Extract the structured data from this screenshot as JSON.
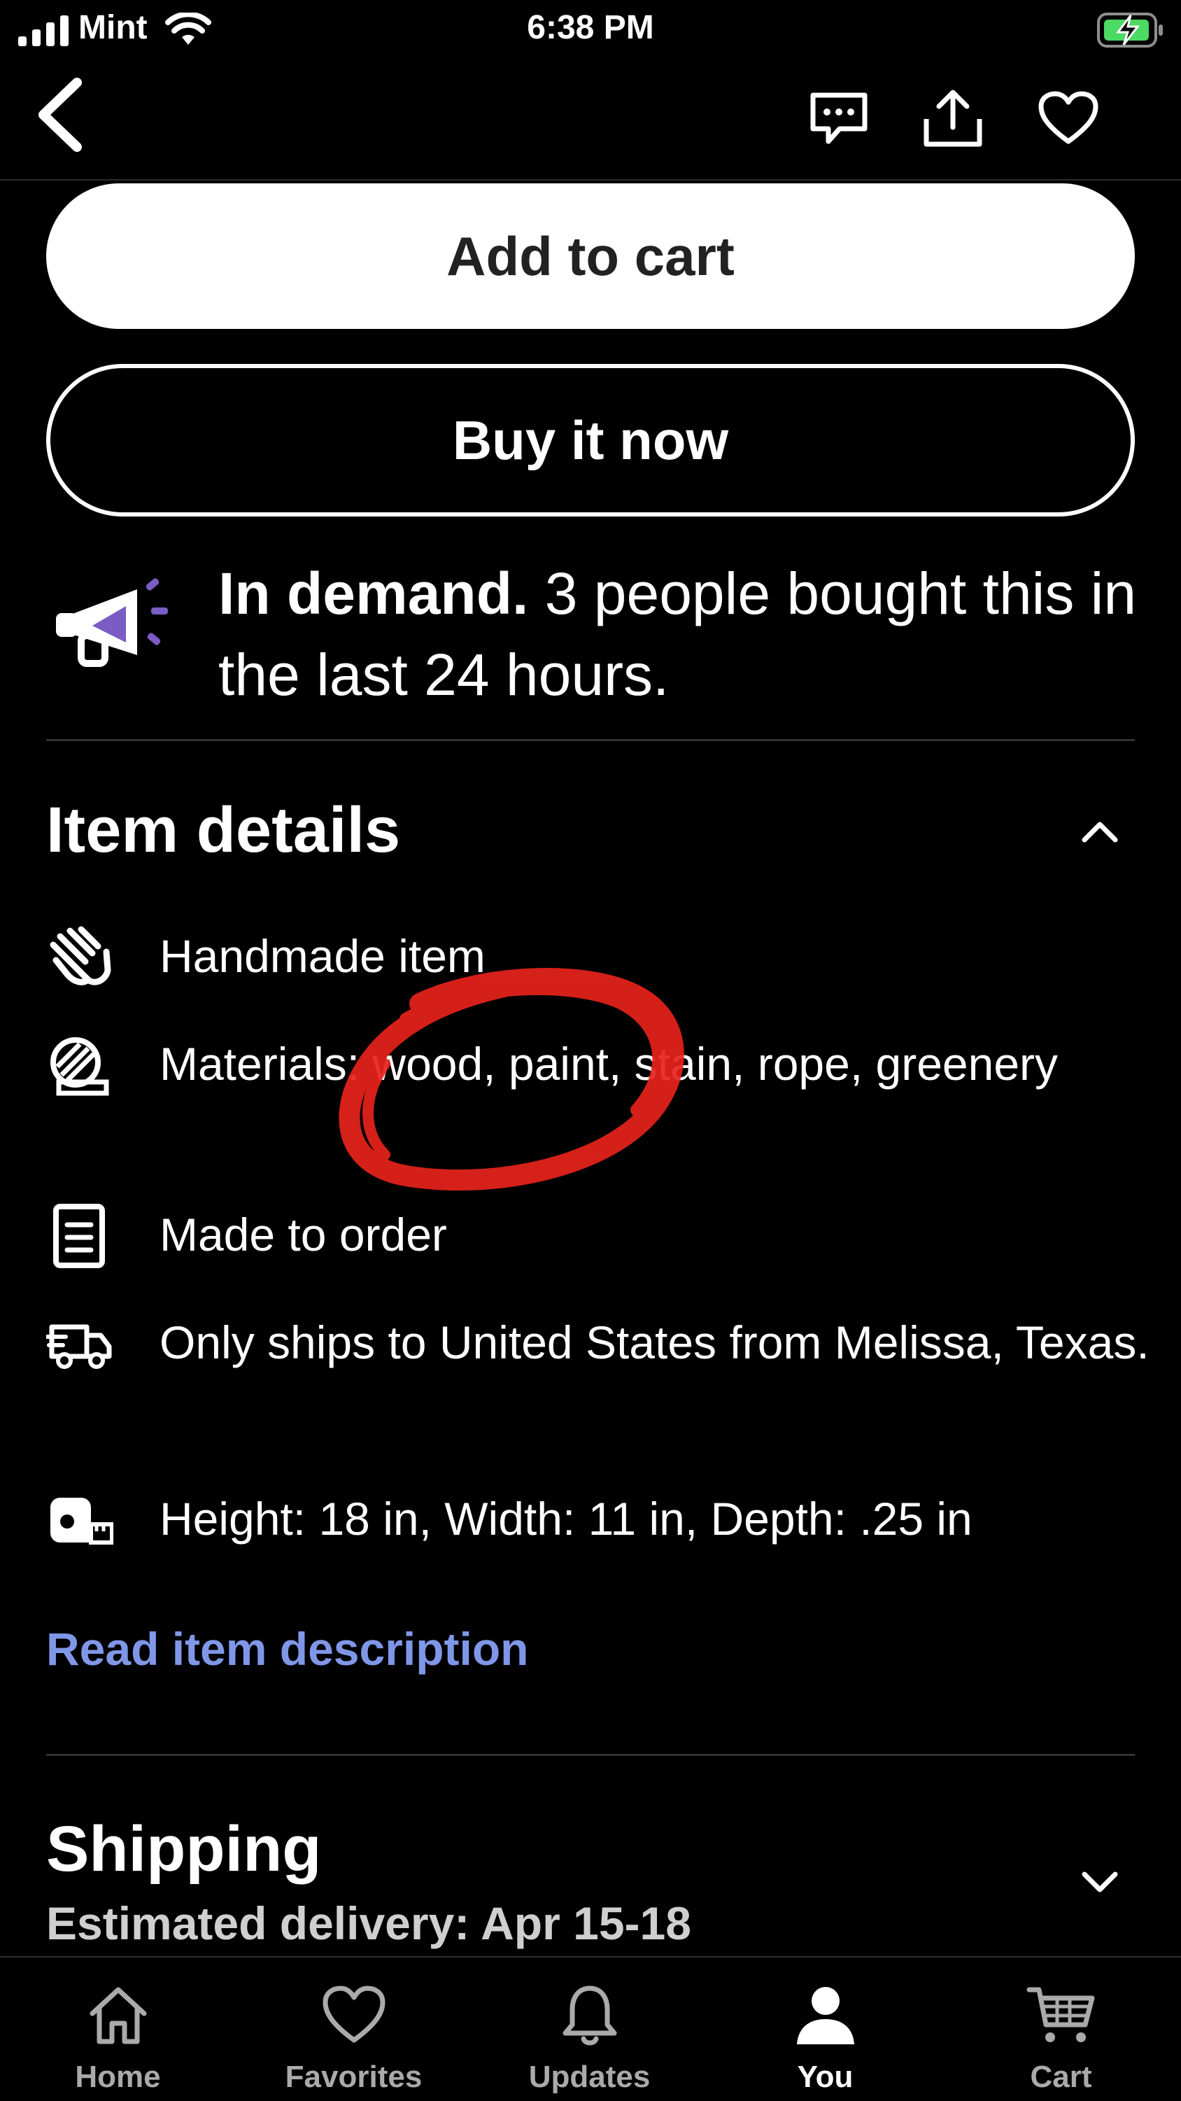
{
  "status_bar": {
    "carrier": "Mint",
    "time": "6:38 PM",
    "icons": [
      "signal-icon",
      "wifi-icon",
      "battery-charging-icon"
    ]
  },
  "top_nav": {
    "icons": [
      "back-icon",
      "message-icon",
      "share-icon",
      "favorite-heart-icon"
    ]
  },
  "actions": {
    "add_to_cart": "Add to cart",
    "buy_now": "Buy it now"
  },
  "demand": {
    "title": "In demand.",
    "text": " 3 people bought this in the last 24 hours.",
    "icon": "megaphone-icon",
    "accent_color": "#7b5cc4"
  },
  "item_details": {
    "title": "Item details",
    "rows": [
      {
        "icon": "hand-icon",
        "text": "Handmade item"
      },
      {
        "icon": "materials-icon",
        "text": "Materials: wood, paint, stain, rope, greenery"
      },
      {
        "icon": "document-icon",
        "text": "Made to order"
      },
      {
        "icon": "shipping-truck-icon",
        "text": "Only ships to United States from Melissa, Texas."
      },
      {
        "icon": "tape-measure-icon",
        "text": "Height: 18 in, Width: 11 in, Depth: .25 in"
      }
    ],
    "read_link": "Read item description",
    "link_color": "#8097e8"
  },
  "shipping": {
    "title": "Shipping",
    "subtitle": "Estimated delivery: Apr 15-18"
  },
  "annotation_color": "#e8231c",
  "tabs": [
    {
      "label": "Home",
      "icon": "home-icon"
    },
    {
      "label": "Favorites",
      "icon": "heart-icon"
    },
    {
      "label": "Updates",
      "icon": "bell-icon"
    },
    {
      "label": "You",
      "icon": "person-icon",
      "active": true
    },
    {
      "label": "Cart",
      "icon": "cart-icon"
    }
  ]
}
